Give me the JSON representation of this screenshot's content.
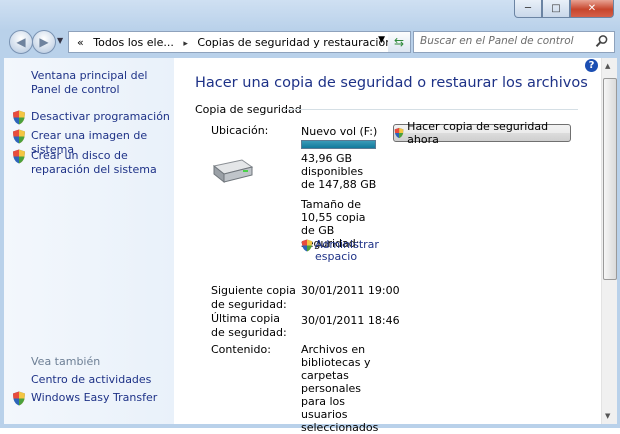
{
  "window": {
    "minimize": "─",
    "maximize": "□",
    "close": "✕"
  },
  "address": {
    "overflow": "«",
    "crumbs": [
      "Todos los ele...",
      "Copias de seguridad y restauración"
    ],
    "separator": "▸",
    "search_placeholder": "Buscar en el Panel de control"
  },
  "sidebar": {
    "home": "Ventana principal del Panel de control",
    "tasks": [
      "Desactivar programación",
      "Crear una imagen de sistema",
      "Crear un disco de reparación del sistema"
    ],
    "see_also_title": "Vea también",
    "see_also": [
      "Centro de actividades",
      "Windows Easy Transfer"
    ]
  },
  "main": {
    "title": "Hacer una copia de seguridad o restaurar los archivos",
    "section": "Copia de seguridad",
    "location_label": "Ubicación:",
    "drive_name": "Nuevo vol (F:)",
    "drive_usage": 1.0,
    "free_space": "43,96 GB disponibles de 147,88 GB",
    "backup_size": "Tamaño de 10,55 copia de GB seguridad:",
    "manage": "Administrar espacio",
    "backup_button": "Hacer copia de seguridad ahora",
    "next_label": "Siguiente copia de seguridad:",
    "next_value": "30/01/2011 19:00",
    "last_label": "Última copia de seguridad:",
    "last_value": "30/01/2011 18:46",
    "contents_label": "Contenido:",
    "contents_value": "Archivos en bibliotecas y carpetas personales para los usuarios seleccionados"
  },
  "help": "?",
  "colors": {
    "link": "#1e3287",
    "accent": "#117a9c"
  }
}
